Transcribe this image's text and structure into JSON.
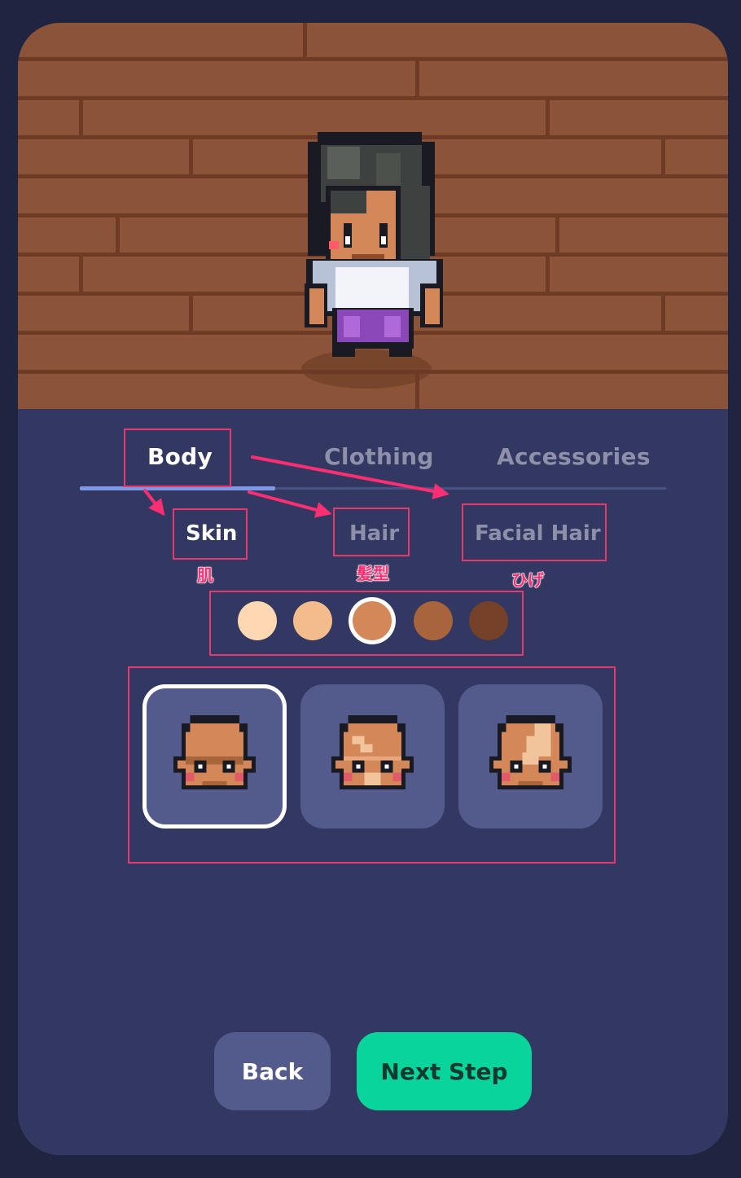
{
  "tabs": [
    {
      "label": "Body",
      "active": true
    },
    {
      "label": "Clothing",
      "active": false
    },
    {
      "label": "Accessories",
      "active": false
    }
  ],
  "subtabs": [
    {
      "label": "Skin",
      "active": true,
      "annotation": "肌"
    },
    {
      "label": "Hair",
      "active": false,
      "annotation": "髪型"
    },
    {
      "label": "Facial Hair",
      "active": false,
      "annotation": "ひげ"
    }
  ],
  "skin_tones": [
    {
      "color": "#fdd8b2",
      "selected": false
    },
    {
      "color": "#f4bc8c",
      "selected": false
    },
    {
      "color": "#d4885a",
      "selected": true
    },
    {
      "color": "#a8643a",
      "selected": false
    },
    {
      "color": "#754128",
      "selected": false
    }
  ],
  "head_options": [
    {
      "icon": "bald-head-plain-icon",
      "selected": true
    },
    {
      "icon": "bald-head-scar-icon",
      "selected": false
    },
    {
      "icon": "bald-head-patch-icon",
      "selected": false
    }
  ],
  "buttons": {
    "back": "Back",
    "next": "Next Step"
  },
  "colors": {
    "background": "#1f2440",
    "panel": "#323862",
    "floor": "#8b5337",
    "accent": "#08d49c",
    "annotation": "#e53a6e"
  }
}
